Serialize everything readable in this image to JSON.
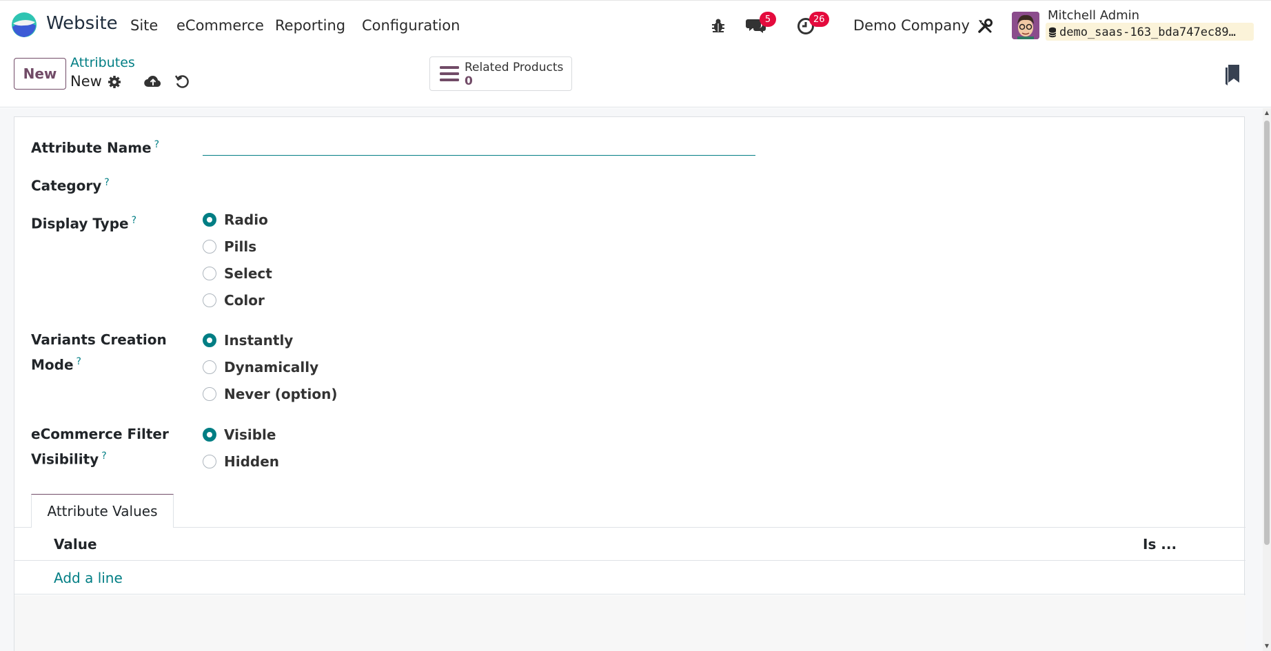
{
  "navbar": {
    "app_name": "Website",
    "menu": [
      "Site",
      "eCommerce",
      "Reporting",
      "Configuration"
    ],
    "messages_count": "5",
    "activities_count": "26",
    "company": "Demo Company",
    "user_name": "Mitchell Admin",
    "database": "demo_saas-163_bda747ec89…"
  },
  "control_panel": {
    "new_button": "New",
    "breadcrumb_parent": "Attributes",
    "breadcrumb_current": "New",
    "smart_button": {
      "label": "Related Products",
      "value": "0"
    }
  },
  "form": {
    "attribute_name_label": "Attribute Name",
    "category_label": "Category",
    "display_type_label": "Display Type",
    "display_type_options": [
      "Radio",
      "Pills",
      "Select",
      "Color"
    ],
    "display_type_selected": "Radio",
    "variants_label_line1": "Variants Creation",
    "variants_label_line2": "Mode",
    "variants_options": [
      "Instantly",
      "Dynamically",
      "Never (option)"
    ],
    "variants_selected": "Instantly",
    "filter_label_line1": "eCommerce Filter",
    "filter_label_line2": "Visibility",
    "filter_options": [
      "Visible",
      "Hidden"
    ],
    "filter_selected": "Visible",
    "help_mark": "?",
    "attribute_name_value": ""
  },
  "tab": {
    "label": "Attribute Values"
  },
  "table": {
    "columns": [
      "Value",
      "Is ..."
    ],
    "add_line": "Add a line"
  },
  "colors": {
    "brand": "#714b67",
    "accent": "#017e84",
    "badge": "#e40b3d"
  }
}
